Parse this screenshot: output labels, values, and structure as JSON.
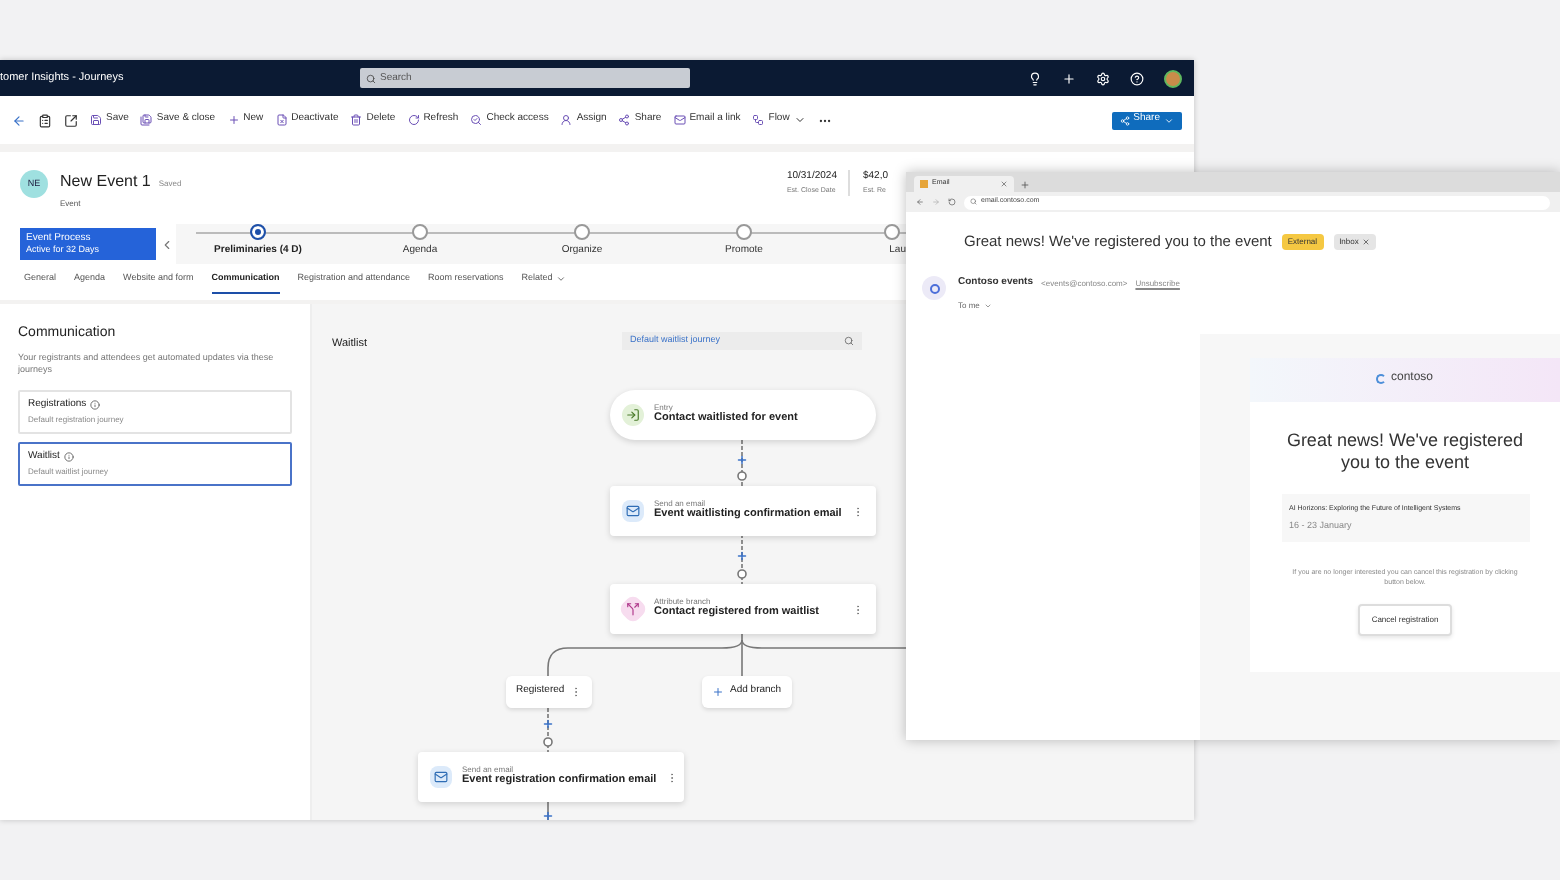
{
  "app": {
    "title": "tomer Insights - Journeys",
    "search_placeholder": "Search"
  },
  "commands": [
    {
      "kind": "save",
      "label": "Save"
    },
    {
      "kind": "save_close",
      "label": "Save & close"
    },
    {
      "kind": "new",
      "label": "New"
    },
    {
      "kind": "deactivate",
      "label": "Deactivate"
    },
    {
      "kind": "delete",
      "label": "Delete"
    },
    {
      "kind": "refresh",
      "label": "Refresh"
    },
    {
      "kind": "check",
      "label": "Check access"
    },
    {
      "kind": "assign",
      "label": "Assign"
    },
    {
      "kind": "share",
      "label": "Share"
    },
    {
      "kind": "email",
      "label": "Email a link"
    },
    {
      "kind": "flow",
      "label": "Flow"
    }
  ],
  "share_button": "Share",
  "record": {
    "initials": "NE",
    "title": "New Event 1",
    "status": "Saved",
    "type": "Event",
    "fields": [
      {
        "value": "10/31/2024",
        "label": "Est. Close Date"
      },
      {
        "value": "$42,0",
        "label": "Est. Re"
      }
    ]
  },
  "process": {
    "name": "Event Process",
    "duration": "Active for 32 Days",
    "stages": [
      {
        "label": "Preliminaries (4 D)",
        "selected": true
      },
      {
        "label": "Agenda",
        "selected": false
      },
      {
        "label": "Organize",
        "selected": false
      },
      {
        "label": "Promote",
        "selected": false
      },
      {
        "label": "Lau",
        "selected": false
      }
    ]
  },
  "tabs": [
    {
      "label": "General",
      "selected": false
    },
    {
      "label": "Agenda",
      "selected": false
    },
    {
      "label": "Website and form",
      "selected": false
    },
    {
      "label": "Communication",
      "selected": true
    },
    {
      "label": "Registration and attendance",
      "selected": false
    },
    {
      "label": "Room reservations",
      "selected": false
    },
    {
      "label": "Related",
      "selected": false
    }
  ],
  "communication": {
    "title": "Communication",
    "description": "Your registrants and attendees get automated updates via these journeys",
    "journeys": [
      {
        "name": "Registrations",
        "subtitle": "Default registration journey",
        "selected": false
      },
      {
        "name": "Waitlist",
        "subtitle": "Default waitlist journey",
        "selected": true
      }
    ]
  },
  "canvas": {
    "title": "Waitlist",
    "search": "Default waitlist journey",
    "nodes": [
      {
        "kind": "entry",
        "caption": "Entry",
        "title": "Contact waitlisted for event"
      },
      {
        "kind": "email",
        "caption": "Send an email",
        "title": "Event waitlisting confirmation email"
      },
      {
        "kind": "branch",
        "caption": "Attribute branch",
        "title": "Contact registered from waitlist"
      },
      {
        "kind": "email",
        "caption": "Send an email",
        "title": "Event registration confirmation email"
      }
    ],
    "branches": [
      {
        "kind": "branch",
        "label": "Registered"
      },
      {
        "kind": "add",
        "label": "Add branch"
      }
    ]
  },
  "email_window": {
    "tab": "Email",
    "address": "email.contoso.com",
    "subject": "Great news! We've registered you to the event",
    "tags": [
      {
        "label": "External",
        "color": "#f5c842"
      },
      {
        "label": "Inbox",
        "color": "#e5e5e5"
      }
    ],
    "sender": "Contoso events",
    "sender_address": "<events@contoso.com>",
    "unsubscribe": "Unsubscribe",
    "recipient": "To me",
    "logo": "contoso",
    "heading": "Great news! We've registered you to the event",
    "event_title": "AI Horizons: Exploring the Future of Intelligent Systems",
    "event_date": "16 - 23 January",
    "note": "If you are no longer interested you can cancel this registration by clicking button below.",
    "button": "Cancel registration"
  }
}
